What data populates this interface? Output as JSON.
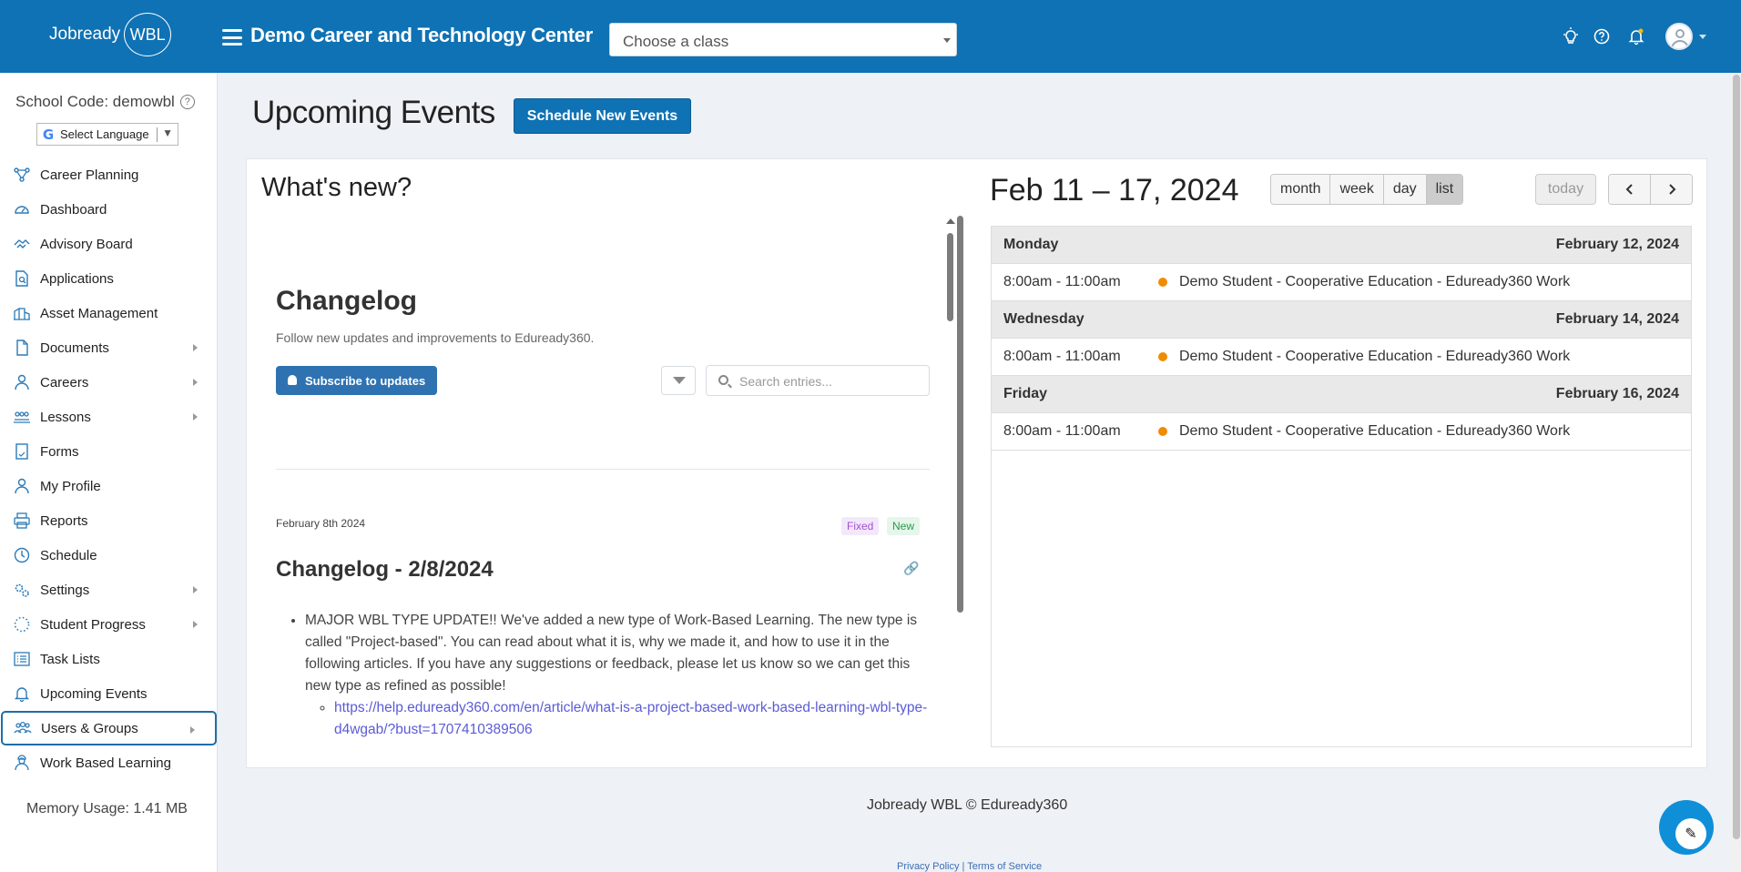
{
  "header": {
    "logo_text": "Jobready",
    "logo_badge": "WBL",
    "org_title": "Demo Career and Technology Center",
    "class_select_placeholder": "Choose a class"
  },
  "sidebar": {
    "school_code": "School Code: demowbl",
    "language_label": "Select Language",
    "items": [
      {
        "label": "Career Planning",
        "icon": "career-planning-icon",
        "has_submenu": false
      },
      {
        "label": "Dashboard",
        "icon": "dashboard-icon",
        "has_submenu": false
      },
      {
        "label": "Advisory Board",
        "icon": "handshake-icon",
        "has_submenu": false
      },
      {
        "label": "Applications",
        "icon": "document-search-icon",
        "has_submenu": false
      },
      {
        "label": "Asset Management",
        "icon": "building-icon",
        "has_submenu": false
      },
      {
        "label": "Documents",
        "icon": "document-icon",
        "has_submenu": true
      },
      {
        "label": "Careers",
        "icon": "person-tie-icon",
        "has_submenu": true
      },
      {
        "label": "Lessons",
        "icon": "people-icon",
        "has_submenu": true
      },
      {
        "label": "Forms",
        "icon": "form-icon",
        "has_submenu": false
      },
      {
        "label": "My Profile",
        "icon": "user-icon",
        "has_submenu": false
      },
      {
        "label": "Reports",
        "icon": "printer-icon",
        "has_submenu": false
      },
      {
        "label": "Schedule",
        "icon": "clock-icon",
        "has_submenu": false
      },
      {
        "label": "Settings",
        "icon": "gears-icon",
        "has_submenu": true
      },
      {
        "label": "Student Progress",
        "icon": "progress-icon",
        "has_submenu": true
      },
      {
        "label": "Task Lists",
        "icon": "list-icon",
        "has_submenu": false
      },
      {
        "label": "Upcoming Events",
        "icon": "bell-icon",
        "has_submenu": false
      },
      {
        "label": "Users & Groups",
        "icon": "users-icon",
        "has_submenu": true,
        "active": true
      },
      {
        "label": "Work Based Learning",
        "icon": "worker-icon",
        "has_submenu": false
      }
    ],
    "memory_usage": "Memory Usage: 1.41 MB"
  },
  "main": {
    "page_title": "Upcoming Events",
    "schedule_button": "Schedule New Events",
    "whats_new": "What's new?"
  },
  "changelog": {
    "title": "Changelog",
    "subtitle": "Follow new updates and improvements to Eduready360.",
    "subscribe_button": "Subscribe to updates",
    "search_placeholder": "Search entries...",
    "entry": {
      "date": "February 8th 2024",
      "tags": [
        "Fixed",
        "New"
      ],
      "title": "Changelog - 2/8/2024",
      "bullet": "MAJOR WBL TYPE UPDATE!! We've added a new type of Work-Based Learning. The new type is called \"Project-based\". You can read about what it is, why we made it, and how to use it in the following articles. If you have any suggestions or feedback, please let us know so we can get this new type as refined as possible!",
      "link": "https://help.eduready360.com/en/article/what-is-a-project-based-work-based-learning-wbl-type-d4wgab/?bust=1707410389506"
    }
  },
  "calendar": {
    "range_title": "Feb 11 – 17, 2024",
    "views": [
      "month",
      "week",
      "day",
      "list"
    ],
    "active_view": "list",
    "today_label": "today",
    "prev_label": "‹",
    "next_label": "›",
    "days": [
      {
        "day": "Monday",
        "date": "February 12, 2024",
        "events": [
          {
            "time": "8:00am - 11:00am",
            "title": "Demo Student - Cooperative Education - Eduready360 Work"
          }
        ]
      },
      {
        "day": "Wednesday",
        "date": "February 14, 2024",
        "events": [
          {
            "time": "8:00am - 11:00am",
            "title": "Demo Student - Cooperative Education - Eduready360 Work"
          }
        ]
      },
      {
        "day": "Friday",
        "date": "February 16, 2024",
        "events": [
          {
            "time": "8:00am - 11:00am",
            "title": "Demo Student - Cooperative Education - Eduready360 Work"
          }
        ]
      }
    ],
    "event_color": "#f08c00"
  },
  "footer": {
    "copyright": "Jobready WBL © Eduready360",
    "privacy": "Privacy Policy",
    "separator": "|",
    "terms": "Terms of Service"
  },
  "colors": {
    "brand": "#0f72b4",
    "active_outline": "#1f6fa6"
  }
}
